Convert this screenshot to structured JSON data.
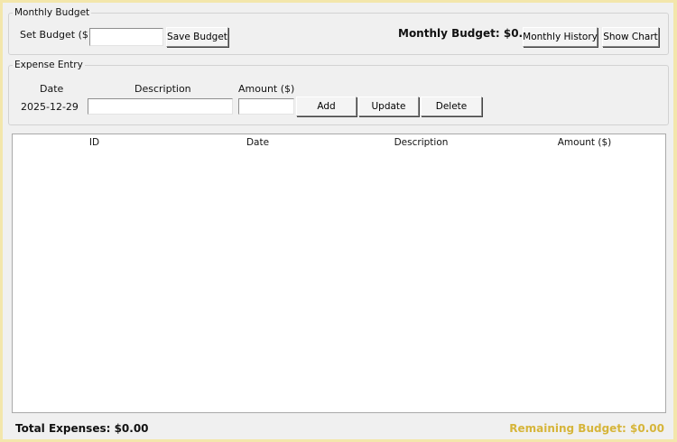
{
  "budget": {
    "group_title": "Monthly Budget",
    "set_label": "Set Budget ($):",
    "input_value": "",
    "save_label": "Save Budget",
    "monthly_budget_text": "Monthly Budget: $0.00",
    "history_label": "Monthly History",
    "chart_label": "Show Chart"
  },
  "entry": {
    "group_title": "Expense Entry",
    "date_label": "Date",
    "description_label": "Description",
    "amount_label": "Amount ($)",
    "date_value": "2025-12-29",
    "description_value": "",
    "amount_value": "",
    "add_label": "Add",
    "update_label": "Update",
    "delete_label": "Delete"
  },
  "table": {
    "columns": [
      "ID",
      "Date",
      "Description",
      "Amount ($)"
    ],
    "rows": []
  },
  "footer": {
    "total_text": "Total Expenses: $0.00",
    "remaining_text": "Remaining Budget: $0.00"
  },
  "colors": {
    "remaining_text": "#d6b53a",
    "window_border": "#f3e6ab"
  }
}
